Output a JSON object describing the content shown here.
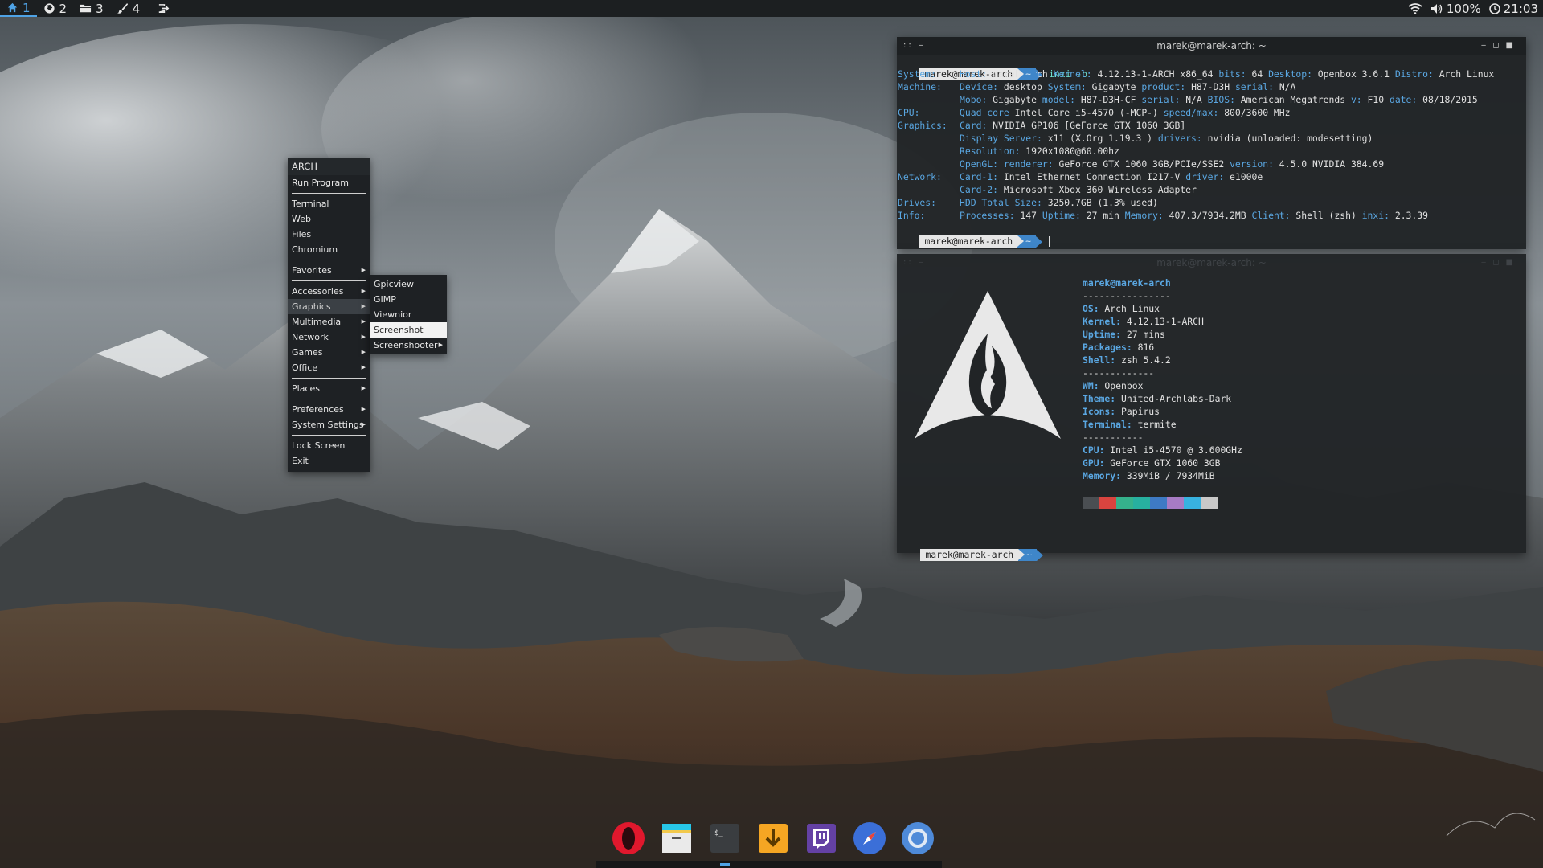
{
  "top_panel": {
    "workspaces": [
      {
        "label": "1",
        "icon": "home-icon",
        "active": true
      },
      {
        "label": "2",
        "icon": "globe-icon",
        "active": false
      },
      {
        "label": "3",
        "icon": "folder-icon",
        "active": false
      },
      {
        "label": "4",
        "icon": "brush-icon",
        "active": false
      }
    ],
    "logout_icon": "logout-icon",
    "tray": {
      "wifi_icon": "wifi-icon",
      "volume": "100%",
      "clock": "21:03",
      "clock_icon": "clock-icon"
    }
  },
  "root_menu": {
    "title": "ARCH",
    "groups": [
      [
        "Run Program"
      ],
      [
        "Terminal",
        "Web",
        "Files",
        "Chromium"
      ],
      [
        "Favorites"
      ],
      [
        "Accessories",
        "Graphics",
        "Multimedia",
        "Network",
        "Games",
        "Office"
      ],
      [
        "Places"
      ],
      [
        "Preferences",
        "System Settings"
      ],
      [
        "Lock Screen",
        "Exit"
      ]
    ],
    "labels": {
      "run_program": "Run Program",
      "terminal": "Terminal",
      "web": "Web",
      "files": "Files",
      "chromium": "Chromium",
      "favorites": "Favorites",
      "accessories": "Accessories",
      "graphics": "Graphics",
      "multimedia": "Multimedia",
      "network": "Network",
      "games": "Games",
      "office": "Office",
      "places": "Places",
      "preferences": "Preferences",
      "system_settings": "System Settings",
      "lock_screen": "Lock Screen",
      "exit": "Exit"
    },
    "open_submenu": "Graphics"
  },
  "graphics_submenu": {
    "items": [
      "Gpicview",
      "GIMP",
      "Viewnior",
      "Screenshot",
      "Screenshooter"
    ],
    "highlighted": "Screenshot"
  },
  "terminal_top": {
    "title": "marek@marek-arch: ~",
    "prompt_user": "marek@marek-arch",
    "prompt_cwd": "~",
    "command": "inxi -b",
    "lines": [
      {
        "label": "System:",
        "text": [
          [
            "k",
            "Host:"
          ],
          [
            "v",
            " marek-arch "
          ],
          [
            "k",
            "Kernel:"
          ],
          [
            "v",
            " 4.12.13-1-ARCH x86_64 "
          ],
          [
            "k",
            "bits:"
          ],
          [
            "v",
            " 64 "
          ],
          [
            "k",
            "Desktop:"
          ],
          [
            "v",
            " Openbox 3.6.1 "
          ],
          [
            "k",
            "Distro:"
          ],
          [
            "v",
            " Arch Linux"
          ]
        ]
      },
      {
        "label": "Machine:",
        "text": [
          [
            "k",
            "Device:"
          ],
          [
            "v",
            " desktop "
          ],
          [
            "k",
            "System:"
          ],
          [
            "v",
            " Gigabyte "
          ],
          [
            "k",
            "product:"
          ],
          [
            "v",
            " H87-D3H "
          ],
          [
            "k",
            "serial:"
          ],
          [
            "v",
            " N/A"
          ]
        ]
      },
      {
        "label": "",
        "text": [
          [
            "k",
            "Mobo:"
          ],
          [
            "v",
            " Gigabyte "
          ],
          [
            "k",
            "model:"
          ],
          [
            "v",
            " H87-D3H-CF "
          ],
          [
            "k",
            "serial:"
          ],
          [
            "v",
            " N/A "
          ],
          [
            "k",
            "BIOS:"
          ],
          [
            "v",
            " American Megatrends "
          ],
          [
            "k",
            "v:"
          ],
          [
            "v",
            " F10 "
          ],
          [
            "k",
            "date:"
          ],
          [
            "v",
            " 08/18/2015"
          ]
        ]
      },
      {
        "label": "CPU:",
        "text": [
          [
            "k",
            "Quad core"
          ],
          [
            "v",
            " Intel Core i5-4570 (-MCP-) "
          ],
          [
            "k",
            "speed/max:"
          ],
          [
            "v",
            " 800/3600 MHz"
          ]
        ]
      },
      {
        "label": "Graphics:",
        "text": [
          [
            "k",
            "Card:"
          ],
          [
            "v",
            " NVIDIA GP106 [GeForce GTX 1060 3GB]"
          ]
        ]
      },
      {
        "label": "",
        "text": [
          [
            "k",
            "Display Server:"
          ],
          [
            "v",
            " x11 (X.Org 1.19.3 ) "
          ],
          [
            "k",
            "drivers:"
          ],
          [
            "v",
            " nvidia (unloaded: modesetting)"
          ]
        ]
      },
      {
        "label": "",
        "text": [
          [
            "k",
            "Resolution:"
          ],
          [
            "v",
            " 1920x1080@60.00hz"
          ]
        ]
      },
      {
        "label": "",
        "text": [
          [
            "k",
            "OpenGL:"
          ],
          [
            "v",
            " "
          ],
          [
            "k",
            "renderer:"
          ],
          [
            "v",
            " GeForce GTX 1060 3GB/PCIe/SSE2 "
          ],
          [
            "k",
            "version:"
          ],
          [
            "v",
            " 4.5.0 NVIDIA 384.69"
          ]
        ]
      },
      {
        "label": "Network:",
        "text": [
          [
            "k",
            "Card-1:"
          ],
          [
            "v",
            " Intel Ethernet Connection I217-V "
          ],
          [
            "k",
            "driver:"
          ],
          [
            "v",
            " e1000e"
          ]
        ]
      },
      {
        "label": "",
        "text": [
          [
            "k",
            "Card-2:"
          ],
          [
            "v",
            " Microsoft Xbox 360 Wireless Adapter"
          ]
        ]
      },
      {
        "label": "Drives:",
        "text": [
          [
            "k",
            "HDD Total Size:"
          ],
          [
            "v",
            " 3250.7GB (1.3% used)"
          ]
        ]
      },
      {
        "label": "Info:",
        "text": [
          [
            "k",
            "Processes:"
          ],
          [
            "v",
            " 147 "
          ],
          [
            "k",
            "Uptime:"
          ],
          [
            "v",
            " 27 min "
          ],
          [
            "k",
            "Memory:"
          ],
          [
            "v",
            " 407.3/7934.2MB "
          ],
          [
            "k",
            "Client:"
          ],
          [
            "v",
            " Shell (zsh) "
          ],
          [
            "k",
            "inxi:"
          ],
          [
            "v",
            " 2.3.39"
          ]
        ]
      }
    ]
  },
  "terminal_bottom": {
    "title": "marek@marek-arch: ~",
    "prompt_user": "marek@marek-arch",
    "prompt_cwd": "~",
    "neofetch": {
      "header": "marek@marek-arch",
      "sep1": "----------------",
      "rows1": [
        [
          "OS:",
          " Arch Linux"
        ],
        [
          "Kernel:",
          " 4.12.13-1-ARCH"
        ],
        [
          "Uptime:",
          " 27 mins"
        ],
        [
          "Packages:",
          " 816"
        ],
        [
          "Shell:",
          " zsh 5.4.2"
        ]
      ],
      "sep2": "-------------",
      "rows2": [
        [
          "WM:",
          " Openbox"
        ],
        [
          "Theme:",
          " United-Archlabs-Dark"
        ],
        [
          "Icons:",
          " Papirus"
        ],
        [
          "Terminal:",
          " termite"
        ]
      ],
      "sep3": "-----------",
      "rows3": [
        [
          "CPU:",
          " Intel i5-4570 @ 3.600GHz"
        ],
        [
          "GPU:",
          " GeForce GTX 1060 3GB"
        ],
        [
          "Memory:",
          " 339MiB / 7934MiB"
        ]
      ],
      "swatches": [
        "#4a4e52",
        "#d9443f",
        "#35b28c",
        "#27b0a0",
        "#3e7ac4",
        "#a77bc4",
        "#38b2e0",
        "#c8c8c8"
      ]
    }
  },
  "dock": {
    "apps": [
      {
        "name": "opera-icon",
        "color": "#e0182d"
      },
      {
        "name": "file-manager-icon",
        "color": "#e9e9e9"
      },
      {
        "name": "terminal-icon",
        "color": "#3a3d40"
      },
      {
        "name": "download-icon",
        "color": "#f5a623"
      },
      {
        "name": "twitch-icon",
        "color": "#6441a4"
      },
      {
        "name": "safari-icon",
        "color": "#3b6fd8"
      },
      {
        "name": "chromium-icon",
        "color": "#4e8ad8"
      }
    ]
  }
}
